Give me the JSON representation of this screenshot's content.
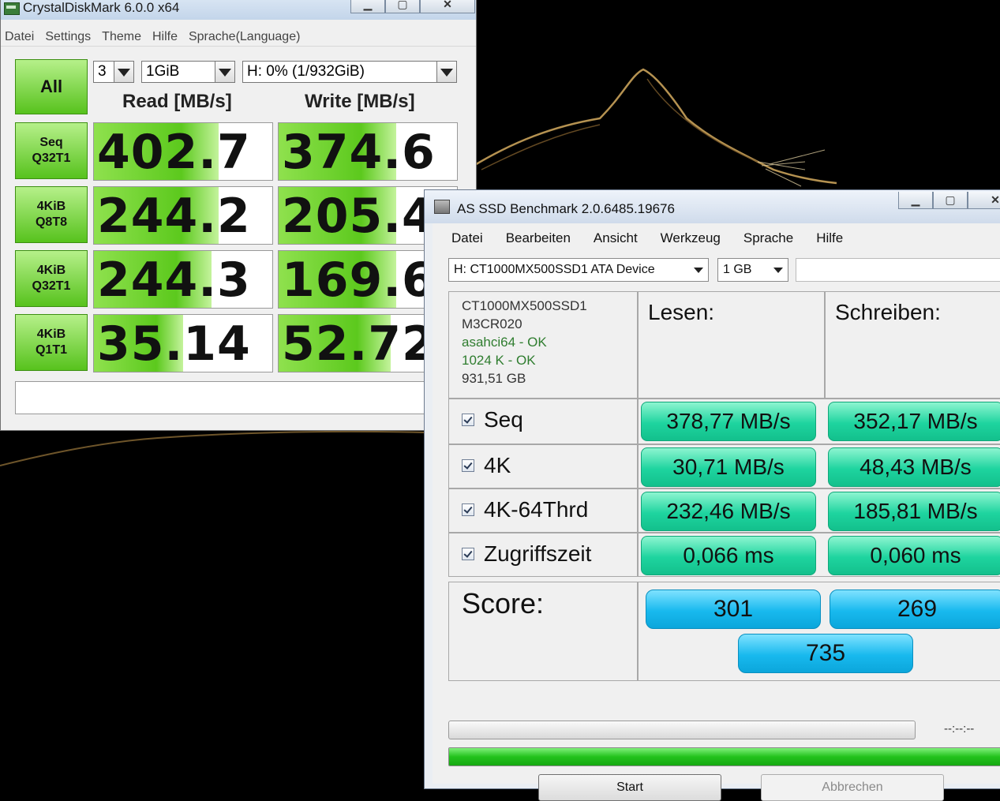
{
  "crystaldiskmark": {
    "title": "CrystalDiskMark 6.0.0 x64",
    "menu": [
      "Datei",
      "Settings",
      "Theme",
      "Hilfe",
      "Sprache(Language)"
    ],
    "all_button": "All",
    "runs": "3",
    "size": "1GiB",
    "drive": "H: 0% (1/932GiB)",
    "read_header": "Read [MB/s]",
    "write_header": "Write [MB/s]",
    "accent_color": "#57c21d",
    "rows": [
      {
        "line1": "Seq",
        "line2": "Q32T1",
        "read": "402.7",
        "write": "374.6",
        "read_fill": 0.7,
        "write_fill": 0.66
      },
      {
        "line1": "4KiB",
        "line2": "Q8T8",
        "read": "244.2",
        "write": "205.4",
        "read_fill": 0.7,
        "write_fill": 0.66
      },
      {
        "line1": "4KiB",
        "line2": "Q32T1",
        "read": "244.3",
        "write": "169.6",
        "read_fill": 0.66,
        "write_fill": 0.66
      },
      {
        "line1": "4KiB",
        "line2": "Q1T1",
        "read": "35.14",
        "write": "52.72",
        "read_fill": 0.5,
        "write_fill": 0.63
      }
    ]
  },
  "as_ssd": {
    "title": "AS SSD Benchmark 2.0.6485.19676",
    "menu": [
      "Datei",
      "Bearbeiten",
      "Ansicht",
      "Werkzeug",
      "Sprache",
      "Hilfe"
    ],
    "device": "H: CT1000MX500SSD1 ATA Device",
    "size": "1 GB",
    "info": {
      "model": "CT1000MX500SSD1",
      "firmware": "M3CR020",
      "driver": "asahci64 - OK",
      "alignment": "1024 K - OK",
      "capacity": "931,51 GB"
    },
    "read_header": "Lesen:",
    "write_header": "Schreiben:",
    "tests": [
      {
        "label": "Seq",
        "read": "378,77 MB/s",
        "write": "352,17 MB/s"
      },
      {
        "label": "4K",
        "read": "30,71 MB/s",
        "write": "48,43 MB/s"
      },
      {
        "label": "4K-64Thrd",
        "read": "232,46 MB/s",
        "write": "185,81 MB/s"
      },
      {
        "label": "Zugriffszeit",
        "read": "0,066 ms",
        "write": "0,060 ms"
      }
    ],
    "score_label": "Score:",
    "score_read": "301",
    "score_write": "269",
    "score_total": "735",
    "elapsed": "--:--:--",
    "overall_progress": 1.0,
    "start_label": "Start",
    "cancel_label": "Abbrechen",
    "result_color": "#1ed49f",
    "score_color": "#18b9ee"
  }
}
